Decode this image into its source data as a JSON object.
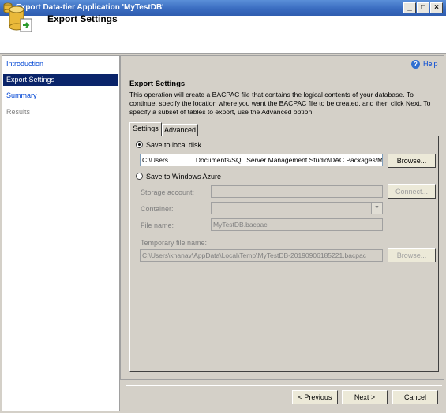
{
  "window": {
    "title": "Export Data-tier Application 'MyTestDB'",
    "controls": {
      "minimize": "_",
      "maximize": "□",
      "close": "×"
    }
  },
  "header": {
    "title": "Export Settings",
    "icon": "database-export-icon"
  },
  "nav": {
    "items": [
      {
        "label": "Introduction",
        "state": "link"
      },
      {
        "label": "Export Settings",
        "state": "active"
      },
      {
        "label": "Summary",
        "state": "link"
      },
      {
        "label": "Results",
        "state": "disabled"
      }
    ]
  },
  "help": {
    "label": "Help"
  },
  "section": {
    "title": "Export Settings",
    "description": "This operation will create a BACPAC file that contains the logical contents of your database. To continue, specify the location where you want the BACPAC file to be created, and then click Next. To specify a subset of tables to export, use the Advanced option."
  },
  "tabs": [
    {
      "label": "Settings"
    },
    {
      "label": "Advanced"
    }
  ],
  "local": {
    "radio_label": "Save to local disk",
    "path_value_start": "C:\\Users",
    "path_value_end": "Documents\\SQL Server Management Studio\\DAC Packages\\My",
    "browse_label": "Browse..."
  },
  "azure": {
    "radio_label": "Save to Windows Azure",
    "storage_account_label": "Storage account:",
    "connect_label": "Connect...",
    "container_label": "Container:",
    "file_name_label": "File name:",
    "file_name_value": "MyTestDB.bacpac",
    "temp_label": "Temporary file name:",
    "temp_value": "C:\\Users\\khanav\\AppData\\Local\\Temp\\MyTestDB-20190906185221.bacpac",
    "browse_label": "Browse..."
  },
  "footer": {
    "previous": "< Previous",
    "next": "Next >",
    "cancel": "Cancel"
  }
}
